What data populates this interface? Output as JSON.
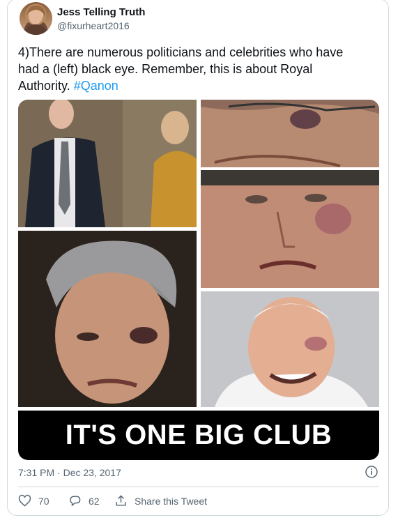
{
  "tweet": {
    "author_name": "Jess Telling Truth",
    "author_handle": "@fixurheart2016",
    "text_main": "4)There are numerous politicians and celebrities who have had a (left) black eye. Remember, this is about Royal Authority.",
    "hashtag": "#Qanon",
    "timestamp": "7:31 PM · Dec 23, 2017"
  },
  "media": {
    "banner_text": "IT'S ONE BIG CLUB"
  },
  "actions": {
    "like_count": "70",
    "reply_count": "62",
    "share_label": "Share this Tweet"
  },
  "colors": {
    "accent": "#1d9bf0",
    "muted": "#536471",
    "border": "#cfd9de"
  },
  "icons": {
    "info": "info-icon",
    "like": "heart-icon",
    "reply": "reply-icon",
    "share": "share-icon"
  }
}
